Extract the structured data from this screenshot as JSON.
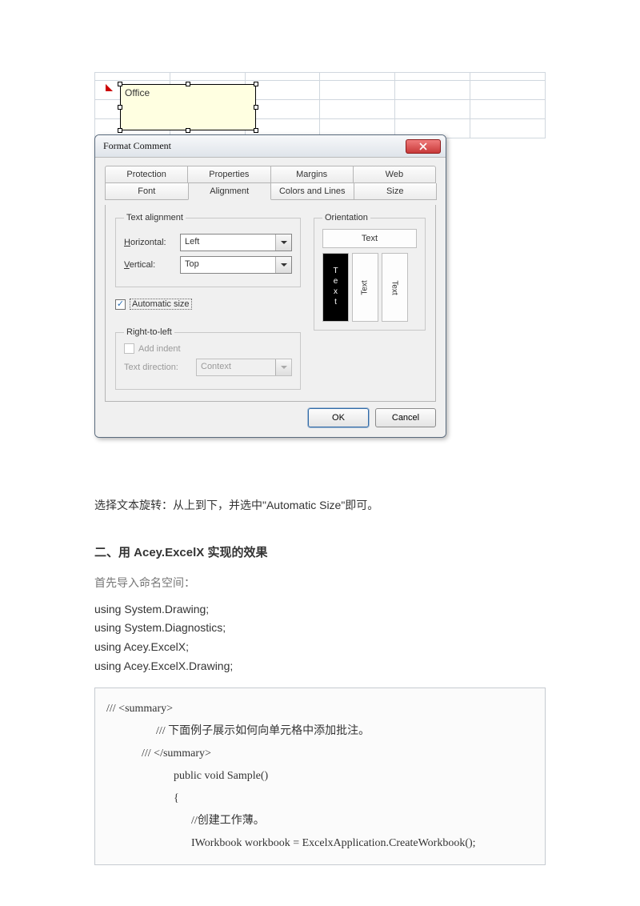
{
  "note": {
    "text": "Office"
  },
  "dialog": {
    "title": "Format Comment",
    "tabs_row1": [
      "Protection",
      "Properties",
      "Margins",
      "Web"
    ],
    "tabs_row2": [
      "Font",
      "Alignment",
      "Colors and Lines",
      "Size"
    ],
    "active_tab": "Alignment",
    "text_alignment": {
      "legend": "Text alignment",
      "horizontal_label": "Horizontal:",
      "horizontal_value": "Left",
      "vertical_label": "Vertical:",
      "vertical_value": "Top"
    },
    "auto_size": {
      "label": "Automatic size",
      "checked": true
    },
    "orientation": {
      "legend": "Orientation",
      "top": "Text",
      "cells": [
        "Text",
        "Text",
        "Text"
      ]
    },
    "rtl": {
      "add_indent": "Add indent",
      "legend": "Right-to-left",
      "dir_label": "Text direction:",
      "dir_value": "Context"
    },
    "buttons": {
      "ok": "OK",
      "cancel": "Cancel"
    }
  },
  "article": {
    "p1": "选择文本旋转：从上到下，并选中\"Automatic Size\"即可。",
    "h2": "二、用 Acey.ExcelX 实现的效果",
    "p2": "首先导入命名空间：",
    "using": [
      "using System.Drawing;",
      "using System.Diagnostics;",
      "using Acey.ExcelX;",
      "using Acey.ExcelX.Drawing;"
    ],
    "code": {
      "l1": "/// <summary>",
      "l2": "///  下面例子展示如何向单元格中添加批注。",
      "l3": "/// </summary>",
      "l4": "public void Sample()",
      "l5": "{",
      "l6": "//创建工作薄。",
      "l7": "IWorkbook workbook = ExcelxApplication.CreateWorkbook();"
    }
  }
}
